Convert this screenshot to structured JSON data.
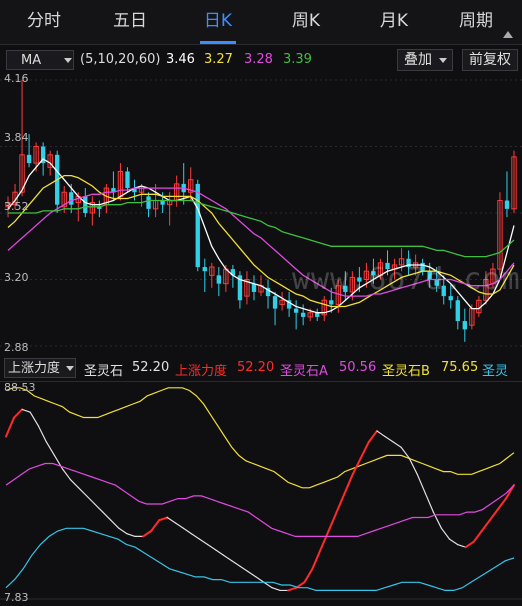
{
  "tabs": [
    {
      "label": "分时"
    },
    {
      "label": "五日"
    },
    {
      "label": "日K",
      "active": true
    },
    {
      "label": "周K"
    },
    {
      "label": "月K"
    },
    {
      "label": "周期"
    }
  ],
  "ma_bar": {
    "selector": "MA",
    "params": "(5,10,20,60)",
    "values": [
      {
        "value": "3.46",
        "color": "#ffffff"
      },
      {
        "value": "3.27",
        "color": "#f2e033"
      },
      {
        "value": "3.28",
        "color": "#e04ae0"
      },
      {
        "value": "3.39",
        "color": "#3fbf3f"
      }
    ],
    "overlay_button": "叠加",
    "adjust_button": "前复权"
  },
  "indicator_bar": {
    "selector": "上涨力度",
    "items": [
      {
        "label": "圣灵石",
        "value": "52.20",
        "color": "#e0e0e0"
      },
      {
        "label": "上涨力度",
        "value": "52.20",
        "color": "#ff2a2a"
      },
      {
        "label": "圣灵石A",
        "value": "50.56",
        "color": "#e04ae0"
      },
      {
        "label": "圣灵石B",
        "value": "75.65",
        "color": "#f2e033"
      },
      {
        "label": "圣灵",
        "value": "",
        "color": "#35c3e8"
      }
    ]
  },
  "watermark": "www.6o7d.com",
  "chart_data": [
    {
      "type": "candlestick",
      "ylim": [
        2.88,
        4.16
      ],
      "yticks": [
        "4.16",
        "3.84",
        "3.52",
        "3.20",
        "2.88"
      ],
      "up_color": "#ff3b3b",
      "down_color": "#2fd0e8",
      "candles": [
        [
          3.55,
          3.6,
          3.5,
          3.57
        ],
        [
          3.56,
          3.66,
          3.54,
          3.62
        ],
        [
          3.62,
          4.16,
          3.6,
          3.8
        ],
        [
          3.8,
          3.9,
          3.74,
          3.76
        ],
        [
          3.76,
          3.86,
          3.72,
          3.84
        ],
        [
          3.84,
          3.86,
          3.7,
          3.76
        ],
        [
          3.74,
          3.82,
          3.7,
          3.8
        ],
        [
          3.8,
          3.82,
          3.52,
          3.56
        ],
        [
          3.55,
          3.65,
          3.52,
          3.62
        ],
        [
          3.62,
          3.66,
          3.52,
          3.56
        ],
        [
          3.57,
          3.62,
          3.48,
          3.6
        ],
        [
          3.6,
          3.64,
          3.5,
          3.52
        ],
        [
          3.52,
          3.6,
          3.46,
          3.57
        ],
        [
          3.55,
          3.58,
          3.5,
          3.54
        ],
        [
          3.56,
          3.66,
          3.52,
          3.64
        ],
        [
          3.64,
          3.72,
          3.58,
          3.62
        ],
        [
          3.6,
          3.76,
          3.58,
          3.72
        ],
        [
          3.72,
          3.74,
          3.62,
          3.64
        ],
        [
          3.64,
          3.68,
          3.58,
          3.62
        ],
        [
          3.62,
          3.66,
          3.55,
          3.64
        ],
        [
          3.6,
          3.62,
          3.5,
          3.54
        ],
        [
          3.54,
          3.66,
          3.5,
          3.58
        ],
        [
          3.58,
          3.62,
          3.52,
          3.56
        ],
        [
          3.56,
          3.62,
          3.46,
          3.58
        ],
        [
          3.58,
          3.7,
          3.55,
          3.66
        ],
        [
          3.66,
          3.76,
          3.56,
          3.62
        ],
        [
          3.62,
          3.74,
          3.58,
          3.68
        ],
        [
          3.66,
          3.68,
          3.24,
          3.26
        ],
        [
          3.26,
          3.3,
          3.14,
          3.24
        ],
        [
          3.22,
          3.28,
          3.16,
          3.26
        ],
        [
          3.22,
          3.26,
          3.12,
          3.18
        ],
        [
          3.18,
          3.27,
          3.14,
          3.25
        ],
        [
          3.25,
          3.27,
          3.16,
          3.22
        ],
        [
          3.22,
          3.24,
          3.06,
          3.1
        ],
        [
          3.12,
          3.24,
          3.08,
          3.2
        ],
        [
          3.18,
          3.22,
          3.1,
          3.14
        ],
        [
          3.14,
          3.22,
          3.12,
          3.17
        ],
        [
          3.16,
          3.2,
          3.06,
          3.12
        ],
        [
          3.12,
          3.14,
          2.98,
          3.06
        ],
        [
          3.08,
          3.14,
          3.05,
          3.1
        ],
        [
          3.1,
          3.14,
          3.02,
          3.06
        ],
        [
          3.06,
          3.1,
          2.96,
          3.04
        ],
        [
          3.04,
          3.08,
          2.98,
          3.02
        ],
        [
          3.02,
          3.06,
          3.0,
          3.04
        ],
        [
          3.04,
          3.06,
          3.0,
          3.02
        ],
        [
          3.03,
          3.12,
          3.0,
          3.1
        ],
        [
          3.1,
          3.16,
          3.04,
          3.08
        ],
        [
          3.08,
          3.2,
          3.04,
          3.17
        ],
        [
          3.17,
          3.24,
          3.1,
          3.14
        ],
        [
          3.14,
          3.24,
          3.1,
          3.21
        ],
        [
          3.21,
          3.26,
          3.14,
          3.19
        ],
        [
          3.2,
          3.28,
          3.16,
          3.24
        ],
        [
          3.24,
          3.3,
          3.18,
          3.22
        ],
        [
          3.22,
          3.3,
          3.2,
          3.28
        ],
        [
          3.28,
          3.34,
          3.22,
          3.25
        ],
        [
          3.25,
          3.3,
          3.2,
          3.27
        ],
        [
          3.27,
          3.35,
          3.24,
          3.3
        ],
        [
          3.3,
          3.34,
          3.22,
          3.26
        ],
        [
          3.26,
          3.32,
          3.22,
          3.28
        ],
        [
          3.28,
          3.3,
          3.22,
          3.24
        ],
        [
          3.24,
          3.28,
          3.16,
          3.2
        ],
        [
          3.2,
          3.26,
          3.14,
          3.17
        ],
        [
          3.17,
          3.22,
          3.08,
          3.12
        ],
        [
          3.12,
          3.18,
          3.06,
          3.1
        ],
        [
          3.1,
          3.12,
          2.96,
          3.0
        ],
        [
          3.0,
          3.06,
          2.9,
          2.96
        ],
        [
          2.98,
          3.08,
          2.96,
          3.06
        ],
        [
          3.04,
          3.12,
          3.02,
          3.1
        ],
        [
          3.1,
          3.24,
          3.08,
          3.2
        ],
        [
          3.18,
          3.28,
          3.16,
          3.25
        ],
        [
          3.25,
          3.62,
          3.22,
          3.58
        ],
        [
          3.58,
          3.72,
          3.5,
          3.54
        ],
        [
          3.54,
          3.82,
          3.52,
          3.79
        ]
      ],
      "series": [
        {
          "values": [
            3.54,
            3.58,
            3.63,
            3.7,
            3.74,
            3.78,
            3.76,
            3.72,
            3.68,
            3.64,
            3.6,
            3.57,
            3.56,
            3.56,
            3.57,
            3.58,
            3.6,
            3.62,
            3.64,
            3.65,
            3.64,
            3.62,
            3.6,
            3.58,
            3.58,
            3.59,
            3.6,
            3.54,
            3.45,
            3.36,
            3.3,
            3.25,
            3.22,
            3.2,
            3.19,
            3.18,
            3.17,
            3.15,
            3.13,
            3.11,
            3.09,
            3.07,
            3.06,
            3.05,
            3.04,
            3.04,
            3.05,
            3.07,
            3.1,
            3.13,
            3.16,
            3.18,
            3.2,
            3.22,
            3.24,
            3.25,
            3.26,
            3.27,
            3.27,
            3.27,
            3.26,
            3.24,
            3.21,
            3.18,
            3.14,
            3.1,
            3.06,
            3.06,
            3.09,
            3.13,
            3.2,
            3.33,
            3.46
          ],
          "color": "#ffffff"
        },
        {
          "values": [
            3.45,
            3.48,
            3.52,
            3.56,
            3.6,
            3.64,
            3.66,
            3.68,
            3.7,
            3.7,
            3.69,
            3.67,
            3.65,
            3.62,
            3.6,
            3.59,
            3.59,
            3.59,
            3.6,
            3.61,
            3.61,
            3.61,
            3.6,
            3.6,
            3.6,
            3.6,
            3.6,
            3.58,
            3.55,
            3.52,
            3.47,
            3.43,
            3.39,
            3.35,
            3.31,
            3.27,
            3.24,
            3.21,
            3.19,
            3.17,
            3.15,
            3.13,
            3.12,
            3.1,
            3.09,
            3.08,
            3.07,
            3.07,
            3.07,
            3.08,
            3.09,
            3.11,
            3.13,
            3.15,
            3.17,
            3.19,
            3.21,
            3.22,
            3.23,
            3.24,
            3.24,
            3.24,
            3.23,
            3.22,
            3.2,
            3.18,
            3.16,
            3.14,
            3.13,
            3.13,
            3.15,
            3.21,
            3.27
          ],
          "color": "#f2e033"
        },
        {
          "values": [
            3.34,
            3.37,
            3.4,
            3.43,
            3.46,
            3.49,
            3.52,
            3.54,
            3.56,
            3.58,
            3.59,
            3.6,
            3.61,
            3.61,
            3.62,
            3.62,
            3.63,
            3.63,
            3.64,
            3.64,
            3.64,
            3.64,
            3.64,
            3.64,
            3.64,
            3.64,
            3.63,
            3.62,
            3.6,
            3.58,
            3.56,
            3.54,
            3.51,
            3.48,
            3.45,
            3.42,
            3.4,
            3.37,
            3.34,
            3.31,
            3.28,
            3.25,
            3.22,
            3.2,
            3.18,
            3.16,
            3.14,
            3.13,
            3.12,
            3.12,
            3.12,
            3.12,
            3.13,
            3.13,
            3.14,
            3.15,
            3.16,
            3.17,
            3.18,
            3.19,
            3.2,
            3.2,
            3.2,
            3.2,
            3.19,
            3.18,
            3.17,
            3.17,
            3.17,
            3.18,
            3.2,
            3.24,
            3.28
          ],
          "color": "#e04ae0"
        },
        {
          "values": [
            3.52,
            3.52,
            3.52,
            3.52,
            3.52,
            3.53,
            3.53,
            3.53,
            3.54,
            3.54,
            3.54,
            3.55,
            3.55,
            3.55,
            3.56,
            3.56,
            3.56,
            3.57,
            3.57,
            3.57,
            3.58,
            3.58,
            3.58,
            3.58,
            3.58,
            3.58,
            3.58,
            3.57,
            3.56,
            3.55,
            3.54,
            3.53,
            3.52,
            3.51,
            3.5,
            3.49,
            3.48,
            3.46,
            3.45,
            3.43,
            3.42,
            3.41,
            3.4,
            3.39,
            3.38,
            3.37,
            3.36,
            3.36,
            3.36,
            3.36,
            3.36,
            3.36,
            3.36,
            3.36,
            3.36,
            3.36,
            3.36,
            3.36,
            3.36,
            3.36,
            3.35,
            3.34,
            3.34,
            3.33,
            3.32,
            3.31,
            3.31,
            3.31,
            3.31,
            3.32,
            3.33,
            3.36,
            3.39
          ],
          "color": "#3fbf3f"
        }
      ]
    },
    {
      "type": "line",
      "ylim": [
        7.83,
        88.53
      ],
      "yticks": [
        "88.53",
        "7.83"
      ],
      "series": [
        {
          "values": [
            85,
            86,
            86,
            85,
            83,
            82,
            81,
            80,
            79,
            77,
            76,
            75,
            75,
            75,
            76,
            77,
            78,
            79,
            80,
            81,
            83,
            84,
            85,
            86,
            86,
            86,
            85,
            83,
            80,
            76,
            72,
            68,
            64,
            61,
            59,
            58,
            57,
            56,
            55,
            53,
            51,
            50,
            49,
            49,
            50,
            51,
            52,
            53,
            55,
            56,
            57,
            58,
            59,
            60,
            61,
            61,
            61,
            60,
            59,
            58,
            57,
            56,
            55,
            55,
            54,
            54,
            54,
            55,
            56,
            57,
            58,
            60,
            62
          ],
          "color": "#f2e033"
        },
        {
          "values": [
            68,
            75,
            78,
            77,
            72,
            66,
            61,
            56,
            52,
            49,
            46,
            43,
            40,
            37,
            34,
            32,
            31,
            31,
            33,
            37,
            38,
            36,
            34,
            32,
            30,
            28,
            26,
            24,
            22,
            20,
            18,
            16,
            14,
            12,
            11,
            11,
            12,
            14,
            19,
            26,
            33,
            40,
            47,
            54,
            60,
            66,
            70,
            68,
            66,
            64,
            60,
            54,
            47,
            40,
            34,
            30,
            28,
            27,
            29,
            33,
            37,
            41,
            45,
            50
          ],
          "color": "#ff2a2a"
        },
        {
          "values": [
            50,
            52,
            54,
            56,
            57,
            58,
            58,
            57,
            56,
            55,
            54,
            53,
            52,
            51,
            50,
            48,
            46,
            44,
            43,
            43,
            43,
            44,
            45,
            45,
            46,
            46,
            45,
            44,
            43,
            42,
            41,
            40,
            38,
            36,
            34,
            33,
            32,
            31,
            31,
            31,
            31,
            31,
            31,
            31,
            31,
            31,
            32,
            33,
            34,
            35,
            36,
            37,
            38,
            38,
            38,
            39,
            39,
            39,
            39,
            40,
            40,
            41,
            43,
            45,
            47,
            50
          ],
          "color": "#e04ae0"
        },
        {
          "values": [
            12,
            15,
            19,
            24,
            28,
            31,
            33,
            34,
            34,
            34,
            33,
            32,
            31,
            30,
            28,
            27,
            25,
            23,
            21,
            19,
            18,
            17,
            16,
            16,
            15,
            15,
            14,
            14,
            14,
            14,
            14,
            14,
            13,
            13,
            12,
            12,
            11,
            11,
            11,
            11,
            11,
            11,
            11,
            11,
            12,
            13,
            14,
            14,
            14,
            13,
            12,
            11,
            11,
            12,
            14,
            16,
            18,
            20,
            22,
            23
          ],
          "color": "#35c3e8"
        }
      ]
    }
  ]
}
